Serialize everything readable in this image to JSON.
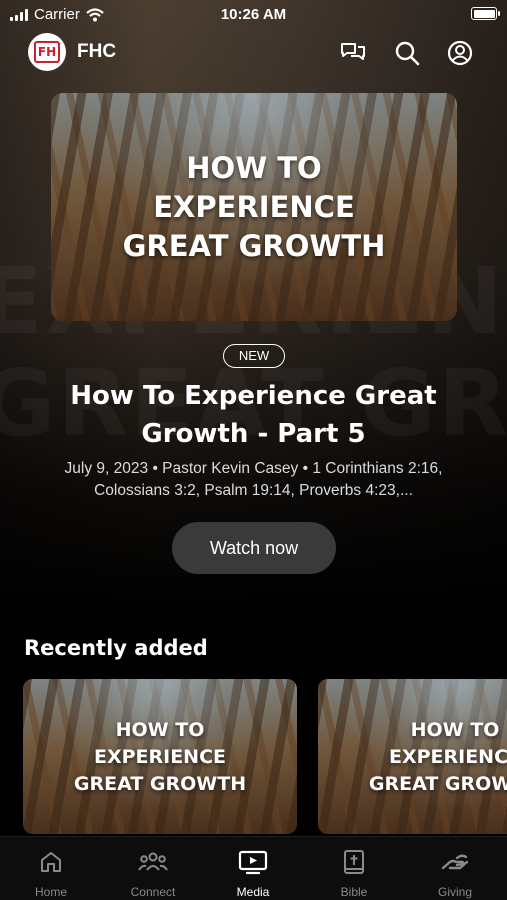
{
  "status_bar": {
    "carrier": "Carrier",
    "time": "10:26 AM"
  },
  "header": {
    "logo_text": "FH",
    "app_name": "FHC",
    "icons": [
      "chat-icon",
      "search-icon",
      "profile-icon"
    ]
  },
  "hero": {
    "artwork_lines": [
      "HOW TO",
      "EXPERIENCE",
      "GREAT GROWTH"
    ],
    "badge": "NEW",
    "title": "How To Experience Great Growth - Part 5",
    "meta": "July 9, 2023 • Pastor Kevin Casey • 1 Corinthians 2:16, Colossians 3:2, Psalm 19:14, Proverbs 4:23,...",
    "watch_label": "Watch now"
  },
  "recently_added": {
    "title": "Recently added",
    "items": [
      {
        "artwork_lines": [
          "HOW TO",
          "EXPERIENCE",
          "GREAT GROWTH"
        ]
      },
      {
        "artwork_lines": [
          "HOW TO",
          "EXPERIENCE",
          "GREAT GROWTH"
        ]
      }
    ]
  },
  "tabs": [
    {
      "label": "Home",
      "icon": "home-icon",
      "active": false
    },
    {
      "label": "Connect",
      "icon": "people-icon",
      "active": false
    },
    {
      "label": "Media",
      "icon": "tv-icon",
      "active": true
    },
    {
      "label": "Bible",
      "icon": "bible-icon",
      "active": false
    },
    {
      "label": "Giving",
      "icon": "giving-hand-icon",
      "active": false
    }
  ],
  "colors": {
    "background": "#000000",
    "button": "#3a3a3a",
    "tab_inactive": "#8a8a8a",
    "logo_red": "#c8202e"
  }
}
